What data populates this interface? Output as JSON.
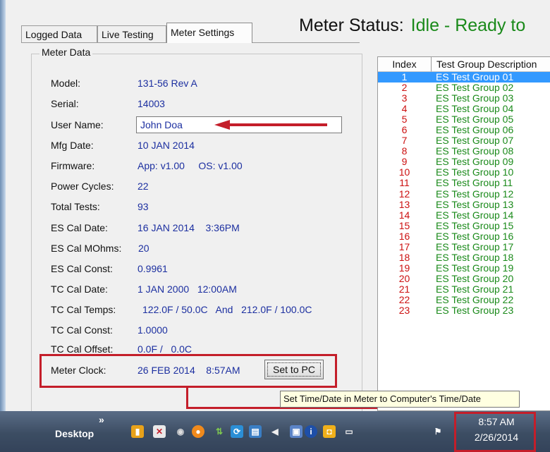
{
  "tabs": [
    "Logged Data",
    "Live Testing",
    "Meter Settings"
  ],
  "meter_status": {
    "label": "Meter Status:",
    "value": "Idle - Ready to"
  },
  "meter_data": {
    "title": "Meter Data",
    "fields": [
      {
        "label": "Model:",
        "value": "131-56  Rev A"
      },
      {
        "label": "Serial:",
        "value": "14003"
      },
      {
        "label": "User Name:",
        "value": "John Doa"
      },
      {
        "label": "Mfg Date:",
        "value": "10 JAN 2014"
      },
      {
        "label": "Firmware:",
        "value": "App: v1.00     OS: v1.00"
      },
      {
        "label": "Power Cycles:",
        "value": "22"
      },
      {
        "label": "Total Tests:",
        "value": "93"
      },
      {
        "label": "ES Cal Date:",
        "value": "16 JAN 2014    3:36PM"
      },
      {
        "label": "ES Cal MOhms:",
        "value": "20"
      },
      {
        "label": "ES Cal Const:",
        "value": "0.9961"
      },
      {
        "label": "TC Cal Date:",
        "value": "1 JAN 2000   12:00AM"
      },
      {
        "label": "TC Cal Temps:",
        "value": "122.0F / 50.0C   And   212.0F / 100.0C"
      },
      {
        "label": "TC Cal Const:",
        "value": "1.0000"
      },
      {
        "label": "TC Cal Offset:",
        "value": "0.0F /   0.0C"
      },
      {
        "label": "Meter Clock:",
        "value": "26 FEB 2014    8:57AM"
      }
    ],
    "set_button": "Set to PC",
    "tooltip": "Set Time/Date in Meter to Computer's Time/Date"
  },
  "table": {
    "headers": [
      "Index",
      "Test Group Description"
    ],
    "rows": [
      {
        "index": "1",
        "desc": "ES Test Group 01"
      },
      {
        "index": "2",
        "desc": "ES Test Group 02"
      },
      {
        "index": "3",
        "desc": "ES Test Group 03"
      },
      {
        "index": "4",
        "desc": "ES Test Group 04"
      },
      {
        "index": "5",
        "desc": "ES Test Group 05"
      },
      {
        "index": "6",
        "desc": "ES Test Group 06"
      },
      {
        "index": "7",
        "desc": "ES Test Group 07"
      },
      {
        "index": "8",
        "desc": "ES Test Group 08"
      },
      {
        "index": "9",
        "desc": "ES Test Group 09"
      },
      {
        "index": "10",
        "desc": "ES Test Group 10"
      },
      {
        "index": "11",
        "desc": "ES Test Group 11"
      },
      {
        "index": "12",
        "desc": "ES Test Group 12"
      },
      {
        "index": "13",
        "desc": "ES Test Group 13"
      },
      {
        "index": "14",
        "desc": "ES Test Group 14"
      },
      {
        "index": "15",
        "desc": "ES Test Group 15"
      },
      {
        "index": "16",
        "desc": "ES Test Group 16"
      },
      {
        "index": "17",
        "desc": "ES Test Group 17"
      },
      {
        "index": "18",
        "desc": "ES Test Group 18"
      },
      {
        "index": "19",
        "desc": "ES Test Group 19"
      },
      {
        "index": "20",
        "desc": "ES Test Group 20"
      },
      {
        "index": "21",
        "desc": "ES Test Group 21"
      },
      {
        "index": "22",
        "desc": "ES Test Group 22"
      },
      {
        "index": "23",
        "desc": "ES Test Group 23"
      }
    ]
  },
  "taskbar": {
    "desktop_label": "Desktop",
    "chevron": "»",
    "tray_icons": [
      "toolbar-icon",
      "pdf-icon",
      "audio-icon",
      "orange-circle-icon",
      "network-icon",
      "sync-icon",
      "screen-icon",
      "volume-icon",
      "monitor-icon",
      "info-icon",
      "office-icon",
      "device-icon",
      "flag-icon"
    ],
    "time": "8:57 AM",
    "date": "2/26/2014"
  },
  "colors": {
    "accent_highlight": "#c41e2a",
    "value_blue": "#1c2fa0",
    "status_green": "#1a8a1a",
    "index_red": "#cc1010",
    "selection_blue": "#3399ff"
  }
}
